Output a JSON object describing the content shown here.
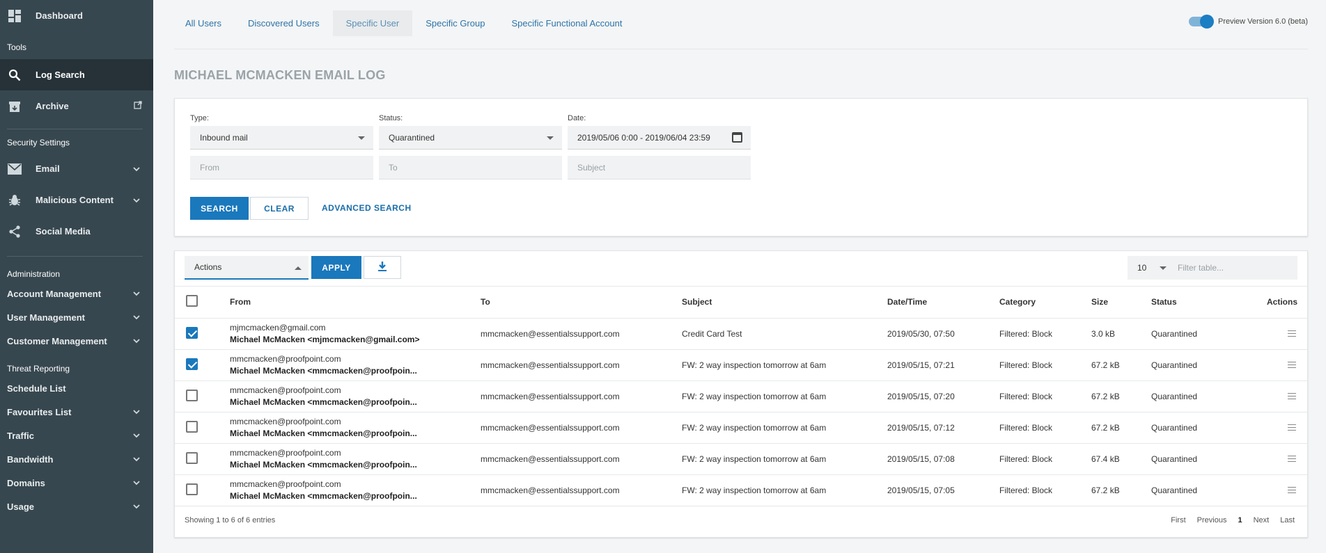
{
  "sidebar": {
    "dashboard": "Dashboard",
    "tools_section": "Tools",
    "log_search": "Log Search",
    "archive": "Archive",
    "security_section": "Security Settings",
    "email": "Email",
    "malicious": "Malicious Content",
    "social": "Social Media",
    "admin_section": "Administration",
    "account_mgmt": "Account Management",
    "user_mgmt": "User Management",
    "customer_mgmt": "Customer Management",
    "threat_section": "Threat Reporting",
    "schedule_list": "Schedule List",
    "favourites_list": "Favourites List",
    "traffic": "Traffic",
    "bandwidth": "Bandwidth",
    "domains": "Domains",
    "usage": "Usage"
  },
  "tabs": [
    "All Users",
    "Discovered Users",
    "Specific User",
    "Specific Group",
    "Specific Functional Account"
  ],
  "preview_label": "Preview Version 6.0 (beta)",
  "page_title": "MICHAEL MCMACKEN EMAIL LOG",
  "search": {
    "type_label": "Type:",
    "type_value": "Inbound mail",
    "status_label": "Status:",
    "status_value": "Quarantined",
    "date_label": "Date:",
    "date_value": "2019/05/06 0:00 - 2019/06/04 23:59",
    "from_placeholder": "From",
    "to_placeholder": "To",
    "subject_placeholder": "Subject",
    "search_btn": "SEARCH",
    "clear_btn": "CLEAR",
    "advanced_btn": "ADVANCED SEARCH"
  },
  "table": {
    "actions_select": "Actions",
    "apply_btn": "APPLY",
    "page_length": "10",
    "filter_placeholder": "Filter table...",
    "headers": {
      "from": "From",
      "to": "To",
      "subject": "Subject",
      "datetime": "Date/Time",
      "category": "Category",
      "size": "Size",
      "status": "Status",
      "actions": "Actions"
    },
    "rows": [
      {
        "checked": true,
        "from_email": "mjmcmacken@gmail.com",
        "from_name": "Michael McMacken <mjmcmacken@gmail.com>",
        "to": "mmcmacken@essentialssupport.com",
        "subject": "Credit Card Test",
        "datetime": "2019/05/30, 07:50",
        "category": "Filtered: Block",
        "size": "3.0 kB",
        "status": "Quarantined"
      },
      {
        "checked": true,
        "from_email": "mmcmacken@proofpoint.com",
        "from_name": "Michael McMacken <mmcmacken@proofpoin...",
        "to": "mmcmacken@essentialssupport.com",
        "subject": "FW: 2 way inspection tomorrow at 6am",
        "datetime": "2019/05/15, 07:21",
        "category": "Filtered: Block",
        "size": "67.2 kB",
        "status": "Quarantined"
      },
      {
        "checked": false,
        "from_email": "mmcmacken@proofpoint.com",
        "from_name": "Michael McMacken <mmcmacken@proofpoin...",
        "to": "mmcmacken@essentialssupport.com",
        "subject": "FW: 2 way inspection tomorrow at 6am",
        "datetime": "2019/05/15, 07:20",
        "category": "Filtered: Block",
        "size": "67.2 kB",
        "status": "Quarantined"
      },
      {
        "checked": false,
        "from_email": "mmcmacken@proofpoint.com",
        "from_name": "Michael McMacken <mmcmacken@proofpoin...",
        "to": "mmcmacken@essentialssupport.com",
        "subject": "FW: 2 way inspection tomorrow at 6am",
        "datetime": "2019/05/15, 07:12",
        "category": "Filtered: Block",
        "size": "67.2 kB",
        "status": "Quarantined"
      },
      {
        "checked": false,
        "from_email": "mmcmacken@proofpoint.com",
        "from_name": "Michael McMacken <mmcmacken@proofpoin...",
        "to": "mmcmacken@essentialssupport.com",
        "subject": "FW: 2 way inspection tomorrow at 6am",
        "datetime": "2019/05/15, 07:08",
        "category": "Filtered: Block",
        "size": "67.4 kB",
        "status": "Quarantined"
      },
      {
        "checked": false,
        "from_email": "mmcmacken@proofpoint.com",
        "from_name": "Michael McMacken <mmcmacken@proofpoin...",
        "to": "mmcmacken@essentialssupport.com",
        "subject": "FW: 2 way inspection tomorrow at 6am",
        "datetime": "2019/05/15, 07:05",
        "category": "Filtered: Block",
        "size": "67.2 kB",
        "status": "Quarantined"
      }
    ],
    "footer_info": "Showing 1 to 6 of 6 entries",
    "pager": {
      "first": "First",
      "previous": "Previous",
      "current": "1",
      "next": "Next",
      "last": "Last"
    }
  }
}
